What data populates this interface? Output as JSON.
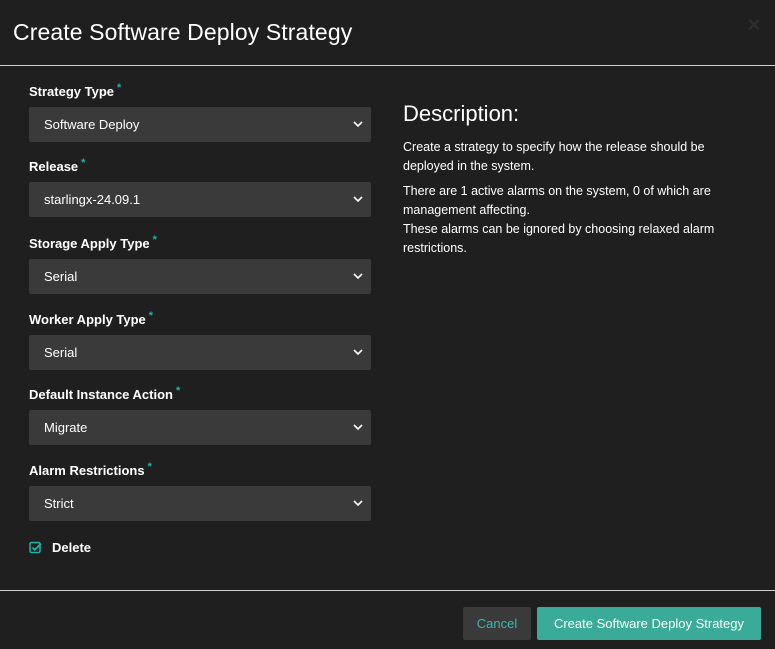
{
  "modal": {
    "title": "Create Software Deploy Strategy",
    "close_glyph": "×"
  },
  "form": {
    "fields": [
      {
        "label": "Strategy Type",
        "value": "Software Deploy"
      },
      {
        "label": "Release",
        "value": "starlingx-24.09.1"
      },
      {
        "label": "Storage Apply Type",
        "value": "Serial"
      },
      {
        "label": "Worker Apply Type",
        "value": "Serial"
      },
      {
        "label": "Default Instance Action",
        "value": "Migrate"
      },
      {
        "label": "Alarm Restrictions",
        "value": "Strict"
      }
    ],
    "required_marker": "*",
    "delete_label": "Delete",
    "delete_checked": true
  },
  "description": {
    "heading": "Description:",
    "p1": "Create a strategy to specify how the release should be deployed in the system.",
    "p2_line1": "There are 1 active alarms on the system, 0 of which are management affecting.",
    "p2_line2": "These alarms can be ignored by choosing relaxed alarm restrictions."
  },
  "footer": {
    "cancel_label": "Cancel",
    "submit_label": "Create Software Deploy Strategy"
  },
  "colors": {
    "accent": "#1ab5a8",
    "primary_button": "#3aaa99",
    "select_bg": "#3a3a3a",
    "background": "#1f1f1f"
  }
}
